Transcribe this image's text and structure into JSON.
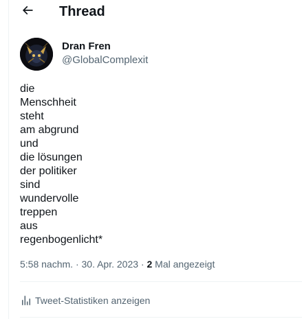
{
  "header": {
    "title": "Thread",
    "back_icon": "arrow-left-icon"
  },
  "author": {
    "display_name": "Dran Fren",
    "handle": "@GlobalComplexit",
    "avatar_icon": "avatar-image"
  },
  "tweet": {
    "lines": [
      "die",
      "Menschheit",
      "steht",
      "am abgrund",
      "und",
      "die lösungen",
      "der politiker",
      "sind",
      "wundervolle",
      "treppen",
      "aus",
      "regenbogenlicht*"
    ]
  },
  "meta": {
    "time": "5:58 nachm.",
    "separator": " · ",
    "date": "30. Apr. 2023",
    "views_count": "2",
    "views_label": " Mal angezeigt"
  },
  "stats": {
    "label": "Tweet-Statistiken anzeigen",
    "icon": "bar-chart-icon"
  },
  "colors": {
    "text_primary": "#0f1419",
    "text_secondary": "#536471",
    "divider": "#eff3f4"
  }
}
